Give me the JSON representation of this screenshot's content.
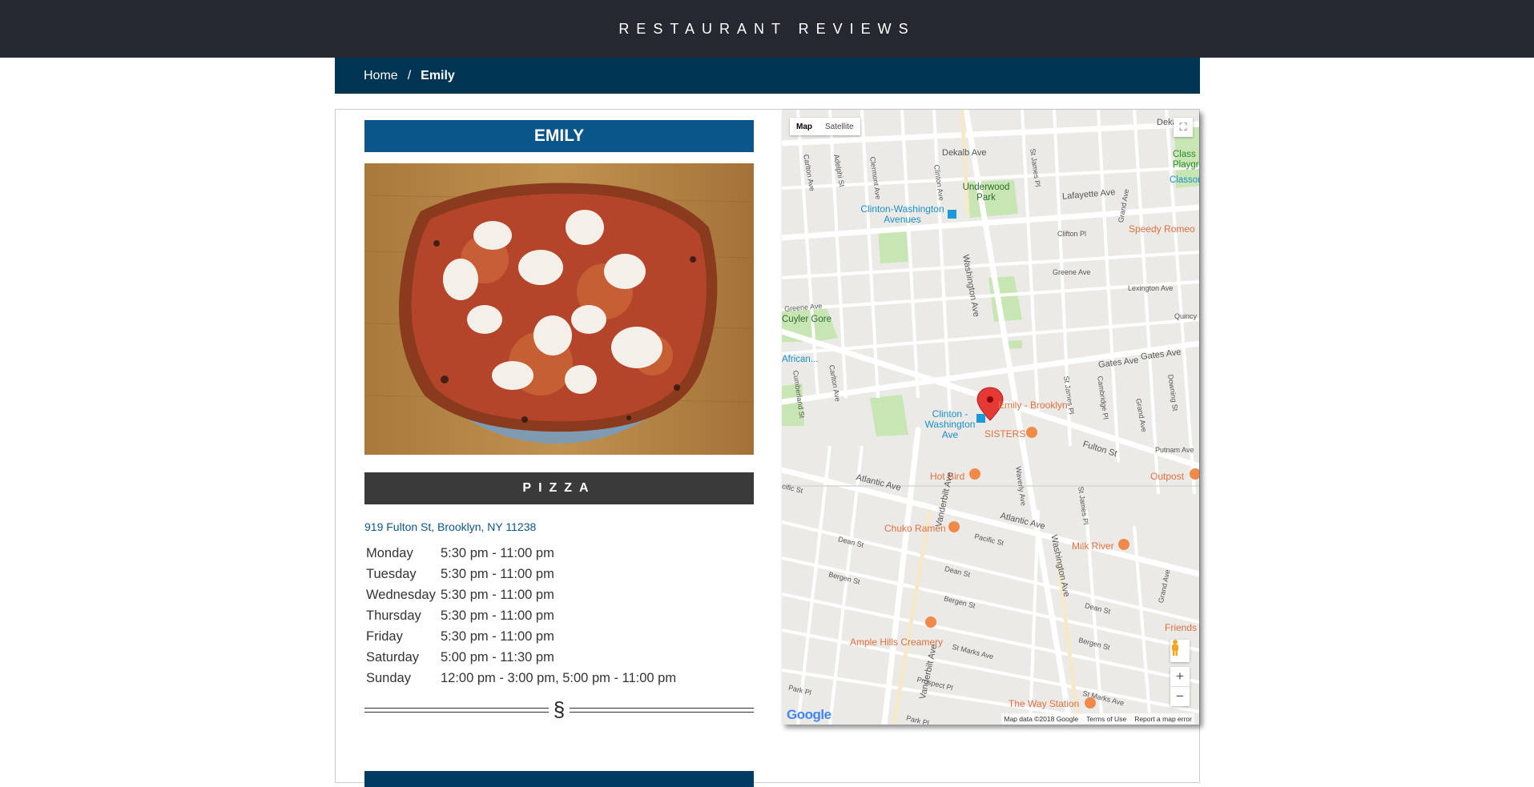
{
  "header": {
    "title": "RESTAURANT REVIEWS"
  },
  "breadcrumb": {
    "home": "Home",
    "separator": "/",
    "current": "Emily"
  },
  "restaurant": {
    "name": "EMILY",
    "photo_alt": "Pizza",
    "cuisine": "PIZZA",
    "address": "919 Fulton St, Brooklyn, NY 11238",
    "hours": [
      {
        "day": "Monday",
        "time": "5:30 pm - 11:00 pm"
      },
      {
        "day": "Tuesday",
        "time": "5:30 pm - 11:00 pm"
      },
      {
        "day": "Wednesday",
        "time": "5:30 pm - 11:00 pm"
      },
      {
        "day": "Thursday",
        "time": "5:30 pm - 11:00 pm"
      },
      {
        "day": "Friday",
        "time": "5:30 pm - 11:00 pm"
      },
      {
        "day": "Saturday",
        "time": "5:00 pm - 11:30 pm"
      },
      {
        "day": "Sunday",
        "time": "12:00 pm - 3:00 pm, 5:00 pm - 11:00 pm"
      }
    ],
    "divider_symbol": "§"
  },
  "map": {
    "type_map": "Map",
    "type_satellite": "Satellite",
    "fullscreen_icon": "⛶",
    "zoom_in": "+",
    "zoom_out": "−",
    "logo": "Google",
    "attribution": {
      "data": "Map data ©2018 Google",
      "terms": "Terms of Use",
      "report": "Report a map error"
    },
    "marker_label": "Emily - Brooklyn",
    "places": {
      "underwood": "Underwood Park",
      "clinton_washington_top": "Clinton-Washington Avenues",
      "clinton_washington_mid": "Clinton - Washington Ave",
      "speedy_romeo": "Speedy Romeo",
      "classon_playground": "Class Playgro",
      "classon_ave_right": "Classon Av",
      "cuyler_gore": "Cuyler Gore",
      "african": "African...",
      "sisters": "SISTERS",
      "hot_bird": "Hot Bird",
      "outpost": "Outpost",
      "chuko_ramen": "Chuko Ramen",
      "milk_river": "Milk River",
      "friends": "Friends",
      "ample_hills": "Ample Hills Creamery",
      "the_way_station": "The Way Station"
    },
    "streets": {
      "dekalb_ave": "Dekalb Ave",
      "dekalb_ave_right": "Dekalb",
      "lafayette_ave": "Lafayette Ave",
      "clifton_pl": "Clifton Pl",
      "greene_ave": "Greene Ave",
      "greene_ave_left": "Greene Ave",
      "lexington_ave": "Lexington Ave",
      "quincy_st": "Quincy St",
      "gates_ave": "Gates Ave",
      "gates_ave_right": "Gates Ave",
      "fulton_st": "Fulton St",
      "putnam_ave": "Putnam Ave",
      "atlantic_ave": "Atlantic Ave",
      "atlantic_ave_right": "Atlantic Ave",
      "pacific_st": "Pacific St",
      "pacific_st_left": "cific St",
      "dean_st": "Dean St",
      "dean_st_mid": "Dean St",
      "dean_st_right": "Dean St",
      "bergen_st": "Bergen St",
      "bergen_st_mid": "Bergen St",
      "bergen_st_right": "Bergen St",
      "st_marks_ave": "St Marks Ave",
      "st_marks_ave_right": "St Marks Ave",
      "prospect_pl": "Prospect Pl",
      "park_pl": "Park Pl",
      "park_pl_bottom": "Park Pl",
      "washington_ave": "Washington Ave",
      "washington_ave_bottom": "Washington Ave",
      "vanderbilt_ave": "Vanderbilt Ave",
      "vanderbilt_ave_bottom": "Vanderbilt Ave",
      "carlton_ave": "Carlton Ave",
      "carlton_ave_mid": "Carlton Ave",
      "adelphi_st": "Adelphi St",
      "clermont_ave": "Clermont Ave",
      "clinton_ave": "Clinton Ave",
      "cumberland_st": "Cumberland St",
      "st_james_pl": "St James Pl",
      "st_james_pl_mid": "St James Pl",
      "st_james_pl_bottom": "St James Pl",
      "grand_ave": "Grand Ave",
      "grand_ave_mid": "Grand Ave",
      "grand_ave_bottom": "Grand Ave",
      "cambridge_pl": "Cambridge Pl",
      "downing_st": "Downing St",
      "waverly_ave": "Waverly Ave"
    }
  }
}
